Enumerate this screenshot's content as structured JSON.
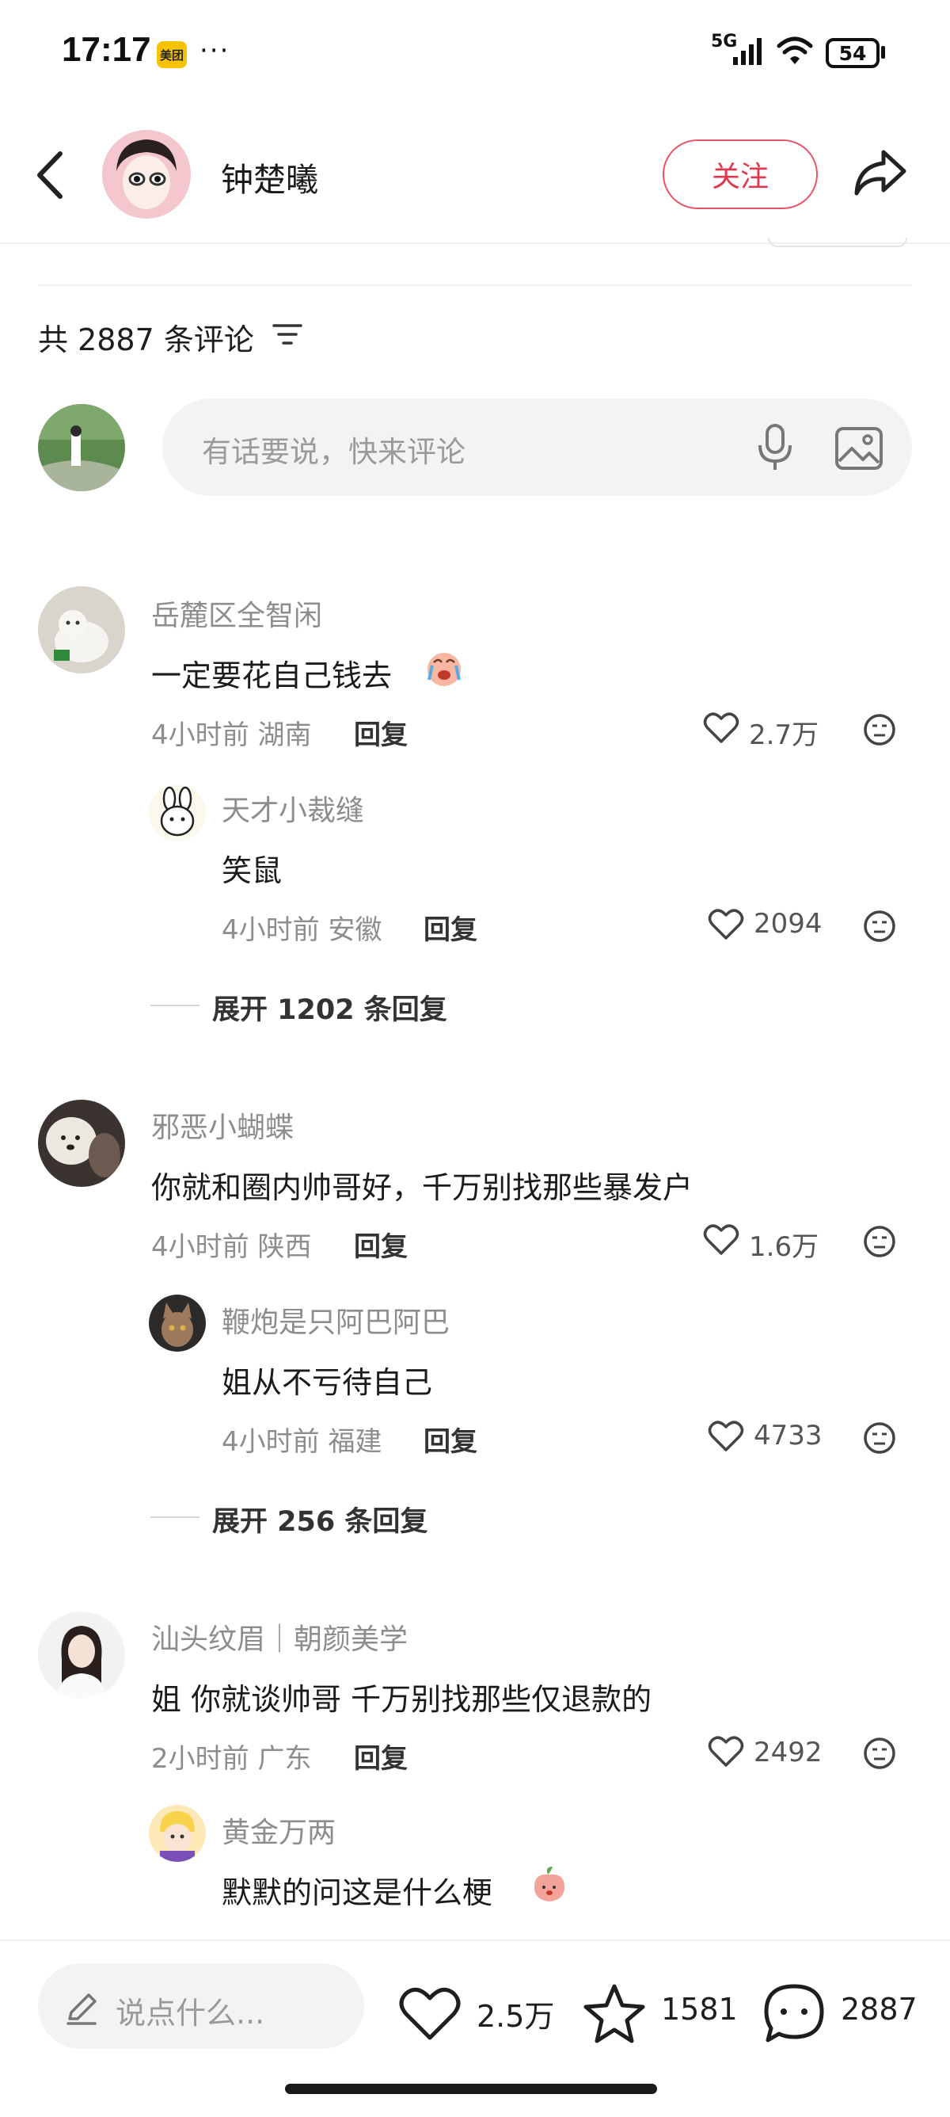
{
  "status_bar": {
    "time": "17:17",
    "app_badge": "美团",
    "more": "···",
    "network": "5G",
    "battery": "54"
  },
  "header": {
    "author": "钟楚曦",
    "follow_label": "关注"
  },
  "comments_header": {
    "count_text": "共 2887 条评论"
  },
  "input": {
    "placeholder": "有话要说，快来评论"
  },
  "comments": [
    {
      "user": "岳麓区全智闲",
      "text": "一定要花自己钱去",
      "time_loc": "4小时前 湖南",
      "reply_label": "回复",
      "likes": "2.7万",
      "sub": {
        "user": "天才小裁缝",
        "text": "笑鼠",
        "time_loc": "4小时前 安徽",
        "reply_label": "回复",
        "likes": "2094"
      },
      "expand": "展开 1202 条回复"
    },
    {
      "user": "邪恶小蝴蝶",
      "text": "你就和圈内帅哥好，千万别找那些暴发户",
      "time_loc": "4小时前 陕西",
      "reply_label": "回复",
      "likes": "1.6万",
      "sub": {
        "user": "鞭炮是只阿巴阿巴",
        "text": "姐从不亏待自己",
        "time_loc": "4小时前 福建",
        "reply_label": "回复",
        "likes": "4733"
      },
      "expand": "展开 256 条回复"
    },
    {
      "user": "汕头纹眉｜朝颜美学",
      "text": "姐 你就谈帅哥 千万别找那些仅退款的",
      "time_loc": "2小时前 广东",
      "reply_label": "回复",
      "likes": "2492",
      "sub": {
        "user": "黄金万两",
        "text": "默默的问这是什么梗"
      }
    }
  ],
  "bottom_bar": {
    "say_placeholder": "说点什么...",
    "likes": "2.5万",
    "favorites": "1581",
    "comments": "2887"
  },
  "colors": {
    "accent": "#e0394f"
  }
}
